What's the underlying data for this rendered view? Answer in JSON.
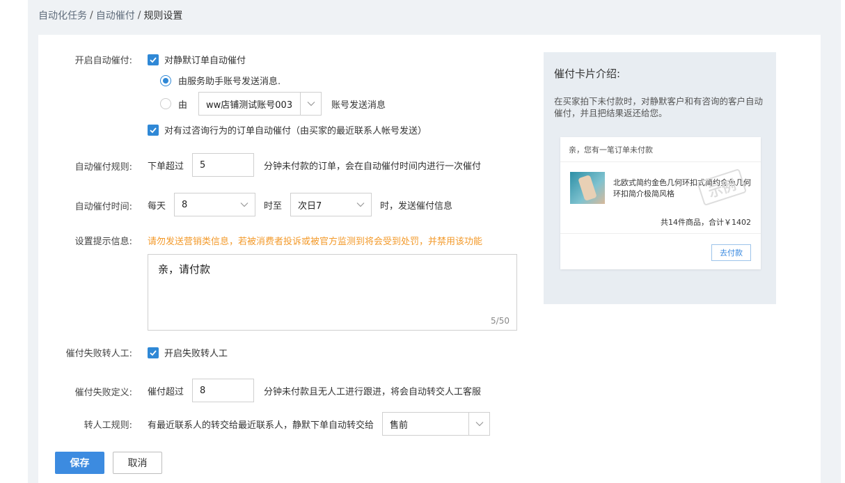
{
  "breadcrumb": {
    "item1": "自动化任务",
    "sep1": "/",
    "item2": "自动催付",
    "sep2": "/",
    "current": "规则设置"
  },
  "form": {
    "auto_remind": {
      "label": "开启自动催付:",
      "silent_orders": {
        "checked": true,
        "text": "对静默订单自动催付"
      },
      "radio_assistant": {
        "selected": true,
        "text": "由服务助手账号发送消息."
      },
      "radio_custom": {
        "selected": false,
        "prefix": "由",
        "account_value": "ww店铺测试账号003",
        "suffix": "账号发送消息"
      },
      "consult_orders": {
        "checked": true,
        "text": "对有过咨询行为的订单自动催付（由买家的最近联系人帐号发送）"
      }
    },
    "rule": {
      "label": "自动催付规则:",
      "prefix": "下单超过",
      "minutes_value": "5",
      "suffix": "分钟未付款的订单，会在自动催付时间内进行一次催付"
    },
    "time": {
      "label": "自动催付时间:",
      "prefix": "每天",
      "start_value": "8",
      "middle": "时至",
      "end_value": "次日7",
      "suffix": "时，发送催付信息"
    },
    "message": {
      "label": "设置提示信息:",
      "warning": "请勿发送营销类信息，若被消费者投诉或被官方监测到将会受到处罚，并禁用该功能",
      "content": "亲，请付款",
      "counter": "5/50"
    },
    "fail_transfer": {
      "label": "催付失败转人工:",
      "checked": true,
      "text": "开启失败转人工"
    },
    "fail_definition": {
      "label": "催付失败定义:",
      "prefix": "催付超过",
      "minutes_value": "8",
      "suffix": "分钟未付款且无人工进行跟进，将会自动转交人工客服"
    },
    "transfer_rule": {
      "label": "转人工规则:",
      "text": "有最近联系人的转交给最近联系人，静默下单自动转交给",
      "select_value": "售前"
    }
  },
  "actions": {
    "save": "保存",
    "cancel": "取消"
  },
  "intro": {
    "title": "催付卡片介绍:",
    "description": "在买家拍下未付款时，对静默客户和有咨询的客户自动催付，并且把结果返还给您。",
    "card": {
      "header": "亲，您有一笔订单未付款",
      "product_name": "北欧式简约金色几何环扣式简约金色几何环扣简介极简风格",
      "stamp": "示例",
      "total": "共14件商品，合计￥1402",
      "pay_button": "去付款"
    }
  },
  "colors": {
    "accent": "#3c8be0",
    "warning": "#f39a2b",
    "page_bg": "#eff2f5",
    "intro_bg": "#e8edf2"
  },
  "icons": [
    "check-icon",
    "chevron-down-icon"
  ]
}
